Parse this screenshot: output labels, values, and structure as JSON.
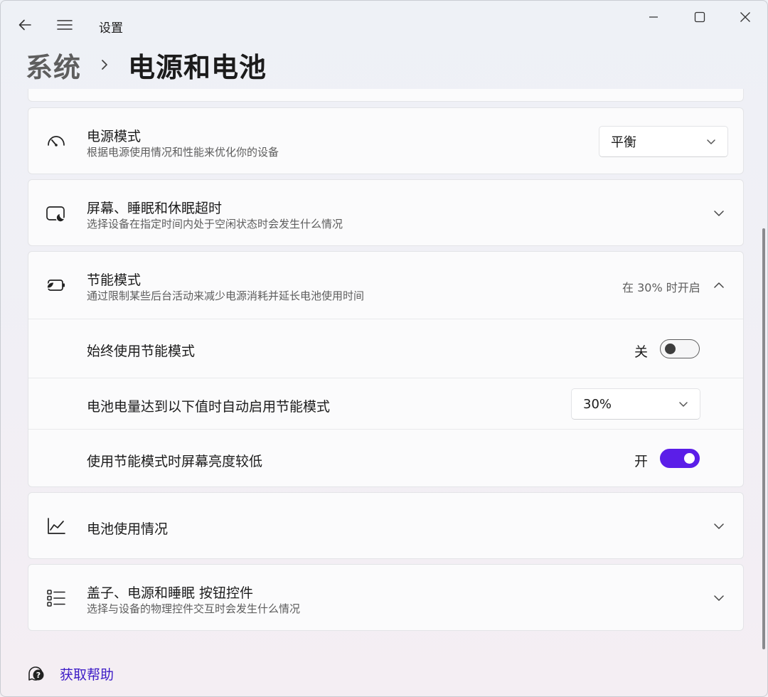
{
  "window": {
    "title": "设置"
  },
  "breadcrumb": {
    "parent": "系统",
    "current": "电源和电池"
  },
  "power_mode": {
    "title": "电源模式",
    "subtitle": "根据电源使用情况和性能来优化你的设备",
    "value": "平衡",
    "icon": "gauge-icon"
  },
  "screen_sleep": {
    "title": "屏幕、睡眠和休眠超时",
    "subtitle": "选择设备在指定时间内处于空闲状态时会发生什么情况",
    "icon": "screen-sleep-icon"
  },
  "energy_saver": {
    "title": "节能模式",
    "subtitle": "通过限制某些后台活动来减少电源消耗并延长电池使用时间",
    "status": "在 30% 时开启",
    "icon": "battery-leaf-icon",
    "always_on": {
      "label": "始终使用节能模式",
      "state_label": "关",
      "on": false
    },
    "threshold": {
      "label": "电池电量达到以下值时自动启用节能模式",
      "value": "30%"
    },
    "lower_brightness": {
      "label": "使用节能模式时屏幕亮度较低",
      "state_label": "开",
      "on": true
    }
  },
  "battery_usage": {
    "title": "电池使用情况",
    "icon": "line-chart-icon"
  },
  "lid_buttons": {
    "title": "盖子、电源和睡眠 按钮控件",
    "subtitle": "选择与设备的物理控件交互时会发生什么情况",
    "icon": "list-icon"
  },
  "help": {
    "label": "获取帮助",
    "icon": "help-icon"
  },
  "colors": {
    "accent": "#5b1ee8",
    "link": "#3c1bc6"
  }
}
